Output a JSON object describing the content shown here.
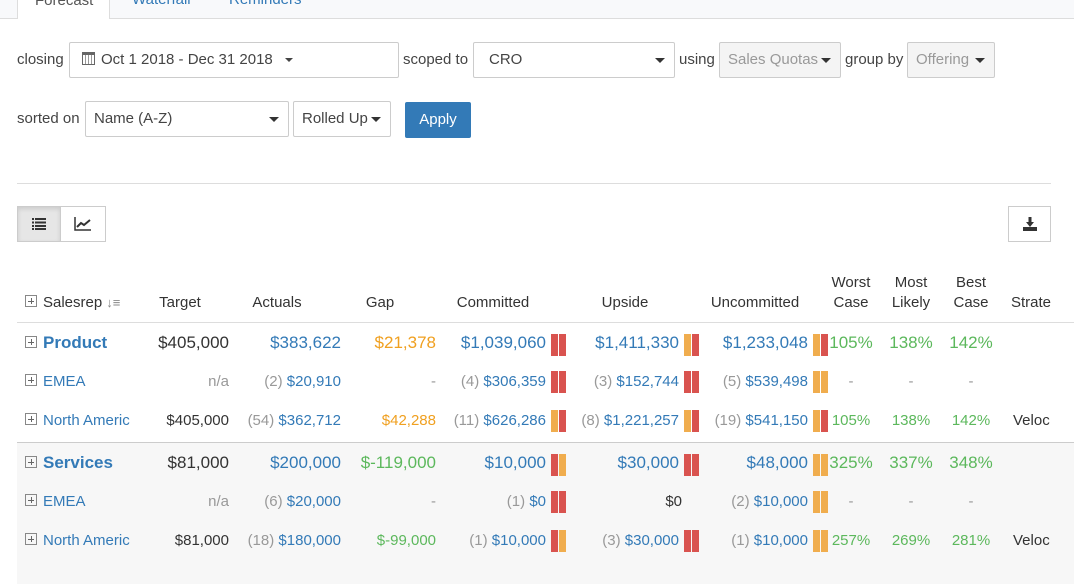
{
  "tabs": [
    "Forecast",
    "Waterfall",
    "Reminders"
  ],
  "filters": {
    "closing_label": "closing",
    "closing_value": "Oct 1 2018 - Dec 31 2018",
    "scoped_label": "scoped to",
    "scoped_value": "CRO",
    "using_label": "using",
    "using_value": "Sales Quotas",
    "group_label": "group by",
    "group_value": "Offering",
    "sorted_label": "sorted on",
    "sorted_value": "Name (A-Z)",
    "rollup_value": "Rolled Up",
    "apply": "Apply"
  },
  "colors": {
    "red": "#d9534f",
    "orange": "#f0ad4e",
    "blue": "#337ab7",
    "green": "#5cb85c"
  },
  "table": {
    "headers": {
      "salesrep": "Salesrep",
      "target": "Target",
      "actuals": "Actuals",
      "gap": "Gap",
      "committed": "Committed",
      "upside": "Upside",
      "uncommitted": "Uncommitted",
      "worst1": "Worst",
      "worst2": "Case",
      "most1": "Most",
      "most2": "Likely",
      "best1": "Best",
      "best2": "Case",
      "strategy": "Strate"
    },
    "rows": [
      {
        "name": "Product",
        "group": true,
        "target": "$405,000",
        "actuals_count": "",
        "actuals": "$383,622",
        "gap": "$21,378",
        "gap_color": "orange",
        "committed_count": "",
        "committed": "$1,039,060",
        "committed_bars": [
          "red",
          "red"
        ],
        "upside_count": "",
        "upside": "$1,411,330",
        "upside_bars": [
          "orange",
          "red"
        ],
        "uncommitted_count": "",
        "uncommitted": "$1,233,048",
        "uncommitted_bars": [
          "orange",
          "red"
        ],
        "worst": "105%",
        "most": "138%",
        "best": "142%",
        "strategy": ""
      },
      {
        "name": "EMEA",
        "group": false,
        "target": "n/a",
        "actuals_count": "(2)",
        "actuals": "$20,910",
        "gap": "-",
        "gap_color": "grey",
        "committed_count": "(4)",
        "committed": "$306,359",
        "committed_bars": [
          "red",
          "red"
        ],
        "upside_count": "(3)",
        "upside": "$152,744",
        "upside_bars": [
          "red",
          "red"
        ],
        "uncommitted_count": "(5)",
        "uncommitted": "$539,498",
        "uncommitted_bars": [
          "orange",
          "orange"
        ],
        "worst": "-",
        "most": "-",
        "best": "-",
        "strategy": ""
      },
      {
        "name": "North Americ",
        "group": false,
        "target": "$405,000",
        "actuals_count": "(54)",
        "actuals": "$362,712",
        "gap": "$42,288",
        "gap_color": "orange",
        "committed_count": "(11)",
        "committed": "$626,286",
        "committed_bars": [
          "orange",
          "red"
        ],
        "upside_count": "(8)",
        "upside": "$1,221,257",
        "upside_bars": [
          "orange",
          "red"
        ],
        "uncommitted_count": "(19)",
        "uncommitted": "$541,150",
        "uncommitted_bars": [
          "orange",
          "red"
        ],
        "worst": "105%",
        "most": "138%",
        "best": "142%",
        "strategy": "Veloc"
      },
      {
        "name": "Services",
        "group": true,
        "target": "$81,000",
        "actuals_count": "",
        "actuals": "$200,000",
        "gap": "$-119,000",
        "gap_color": "green",
        "committed_count": "",
        "committed": "$10,000",
        "committed_bars": [
          "red",
          "orange"
        ],
        "upside_count": "",
        "upside": "$30,000",
        "upside_bars": [
          "red",
          "red"
        ],
        "uncommitted_count": "",
        "uncommitted": "$48,000",
        "uncommitted_bars": [
          "orange",
          "orange"
        ],
        "worst": "325%",
        "most": "337%",
        "best": "348%",
        "strategy": ""
      },
      {
        "name": "EMEA",
        "group": false,
        "target": "n/a",
        "actuals_count": "(6)",
        "actuals": "$20,000",
        "gap": "-",
        "gap_color": "grey",
        "committed_count": "(1)",
        "committed": "$0",
        "committed_bars": [
          "red",
          "red"
        ],
        "upside_count": "",
        "upside": "$0",
        "upside_bars": [],
        "uncommitted_count": "(2)",
        "uncommitted": "$10,000",
        "uncommitted_bars": [
          "orange",
          "orange"
        ],
        "worst": "-",
        "most": "-",
        "best": "-",
        "strategy": ""
      },
      {
        "name": "North Americ",
        "group": false,
        "target": "$81,000",
        "actuals_count": "(18)",
        "actuals": "$180,000",
        "gap": "$-99,000",
        "gap_color": "green",
        "committed_count": "(1)",
        "committed": "$10,000",
        "committed_bars": [
          "red",
          "orange"
        ],
        "upside_count": "(3)",
        "upside": "$30,000",
        "upside_bars": [
          "red",
          "red"
        ],
        "uncommitted_count": "(1)",
        "uncommitted": "$10,000",
        "uncommitted_bars": [
          "orange",
          "orange"
        ],
        "worst": "257%",
        "most": "269%",
        "best": "281%",
        "strategy": "Veloc"
      }
    ]
  }
}
